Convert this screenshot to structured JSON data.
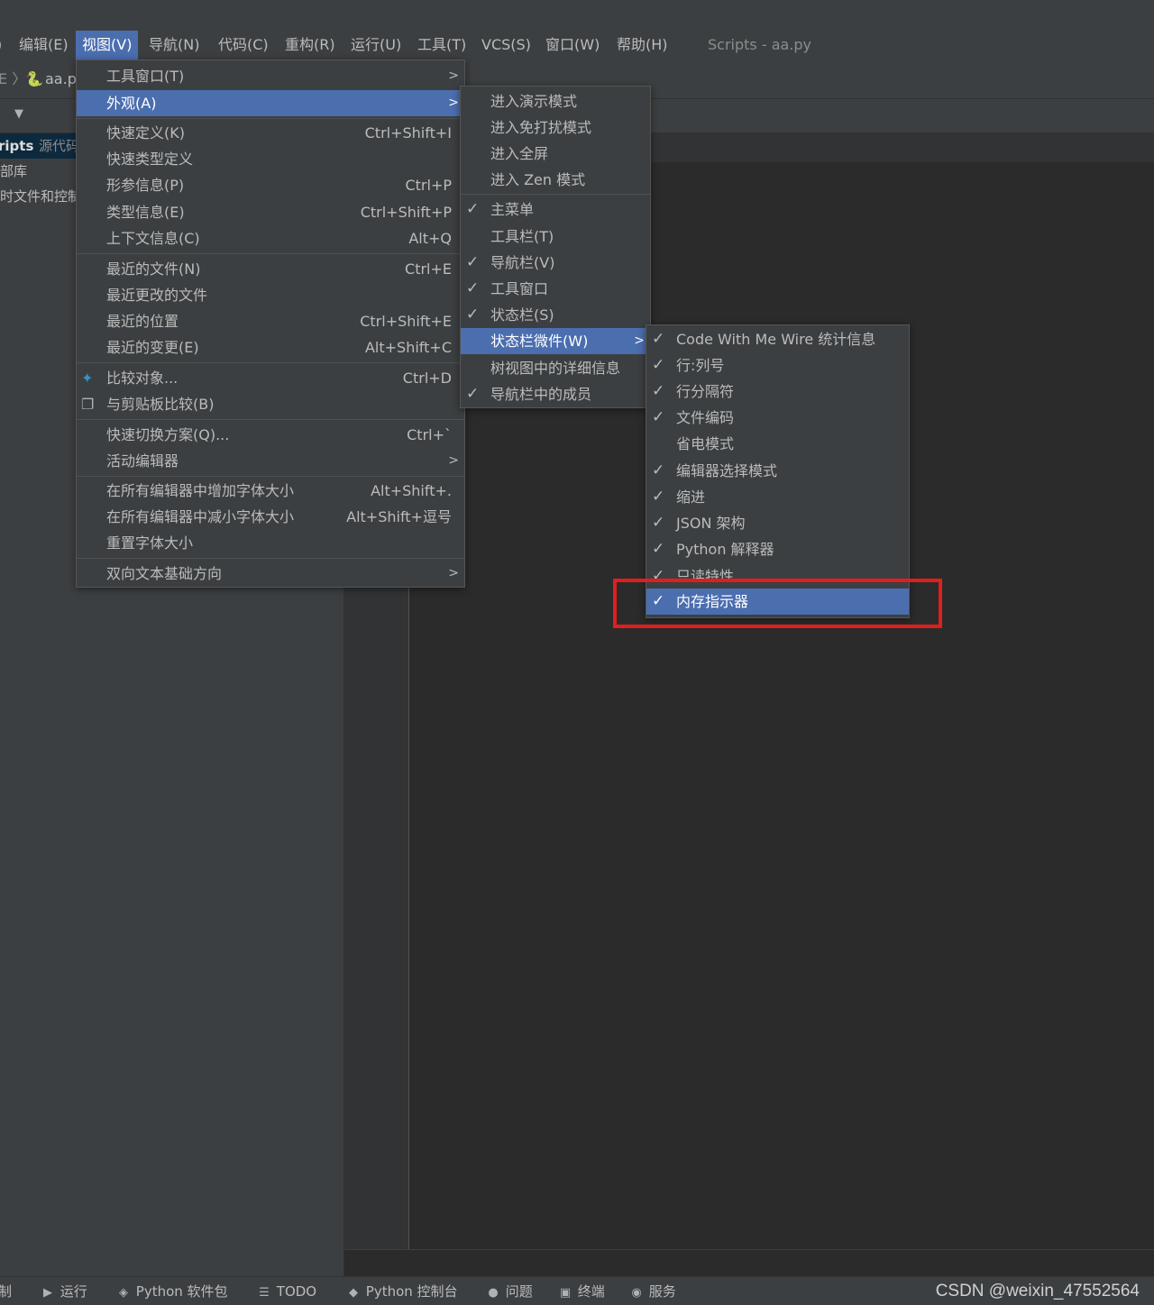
{
  "menubar": {
    "items": [
      "编辑(E)",
      "视图(V)",
      "导航(N)",
      "代码(C)",
      "重构(R)",
      "运行(U)",
      "工具(T)",
      "VCS(S)",
      "窗口(W)",
      "帮助(H)"
    ],
    "window_title": "Scripts - aa.py"
  },
  "navbar": {
    "file": "aa.p"
  },
  "project_tree": {
    "root": "ripts",
    "root_suffix": "源代码",
    "items": [
      "部库",
      "时文件和控制"
    ]
  },
  "view_menu": {
    "items": [
      {
        "label": "工具窗口(T)",
        "shortcut": "",
        "submenu": true
      },
      {
        "label": "外观(A)",
        "shortcut": "",
        "submenu": true
      },
      {
        "label": "快速定义(K)",
        "shortcut": "Ctrl+Shift+I"
      },
      {
        "label": "快速类型定义",
        "shortcut": ""
      },
      {
        "label": "形参信息(P)",
        "shortcut": "Ctrl+P"
      },
      {
        "label": "类型信息(E)",
        "shortcut": "Ctrl+Shift+P"
      },
      {
        "label": "上下文信息(C)",
        "shortcut": "Alt+Q"
      },
      {
        "label": "最近的文件(N)",
        "shortcut": "Ctrl+E"
      },
      {
        "label": "最近更改的文件",
        "shortcut": ""
      },
      {
        "label": "最近的位置",
        "shortcut": "Ctrl+Shift+E"
      },
      {
        "label": "最近的变更(E)",
        "shortcut": "Alt+Shift+C"
      },
      {
        "label": "比较对象...",
        "shortcut": "Ctrl+D",
        "icon": "compare-icon"
      },
      {
        "label": "与剪贴板比较(B)",
        "shortcut": "",
        "icon": "clipboard-compare-icon"
      },
      {
        "label": "快速切换方案(Q)...",
        "shortcut": "Ctrl+`"
      },
      {
        "label": "活动编辑器",
        "shortcut": "",
        "submenu": true
      },
      {
        "label": "在所有编辑器中增加字体大小",
        "shortcut": "Alt+Shift+."
      },
      {
        "label": "在所有编辑器中减小字体大小",
        "shortcut": "Alt+Shift+逗号"
      },
      {
        "label": "重置字体大小",
        "shortcut": ""
      },
      {
        "label": "双向文本基础方向",
        "shortcut": "",
        "submenu": true
      }
    ]
  },
  "appearance_menu": {
    "items": [
      {
        "label": "进入演示模式",
        "checked": false
      },
      {
        "label": "进入免打扰模式",
        "checked": false
      },
      {
        "label": "进入全屏",
        "checked": false
      },
      {
        "label": "进入 Zen 模式",
        "checked": false
      },
      {
        "label": "主菜单",
        "checked": true
      },
      {
        "label": "工具栏(T)",
        "checked": false
      },
      {
        "label": "导航栏(V)",
        "checked": true
      },
      {
        "label": "工具窗口",
        "checked": true
      },
      {
        "label": "状态栏(S)",
        "checked": true
      },
      {
        "label": "状态栏微件(W)",
        "checked": false,
        "submenu": true
      },
      {
        "label": "树视图中的详细信息",
        "checked": false
      },
      {
        "label": "导航栏中的成员",
        "checked": true
      }
    ]
  },
  "widgets_menu": {
    "items": [
      {
        "label": "Code With Me Wire 统计信息",
        "checked": true
      },
      {
        "label": "行:列号",
        "checked": true
      },
      {
        "label": "行分隔符",
        "checked": true
      },
      {
        "label": "文件编码",
        "checked": true
      },
      {
        "label": "省电模式",
        "checked": false
      },
      {
        "label": "编辑器选择模式",
        "checked": true
      },
      {
        "label": "缩进",
        "checked": true
      },
      {
        "label": "JSON 架构",
        "checked": true
      },
      {
        "label": "Python 解释器",
        "checked": true
      },
      {
        "label": "只读特性",
        "checked": true
      },
      {
        "label": "内存指示器",
        "checked": true
      }
    ]
  },
  "glyphs": {
    "check": "✓",
    "arrow": ">"
  },
  "toolwindows": {
    "items": [
      {
        "label": "制",
        "icon": ""
      },
      {
        "label": "运行",
        "icon": "▶"
      },
      {
        "label": "Python 软件包",
        "icon": "◈"
      },
      {
        "label": "TODO",
        "icon": "☰"
      },
      {
        "label": "Python 控制台",
        "icon": "◆"
      },
      {
        "label": "问题",
        "icon": "●"
      },
      {
        "label": "终端",
        "icon": "▣"
      },
      {
        "label": "服务",
        "icon": "◉"
      }
    ]
  },
  "watermark": "CSDN @weixin_47552564",
  "colors": {
    "highlight": "#4b6eaf",
    "callout": "#e01e1e",
    "background": "#2b2b2b",
    "panel": "#3c3f41"
  }
}
